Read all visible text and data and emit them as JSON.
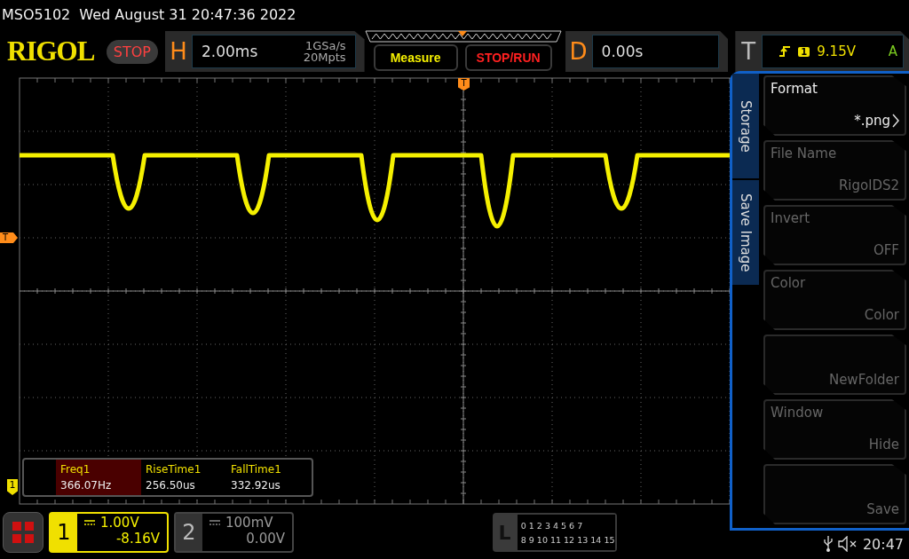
{
  "header": {
    "model": "MSO5102",
    "datetime": "Wed August 31 20:47:36 2022"
  },
  "logo": "RIGOL",
  "run_state": "STOP",
  "horizontal": {
    "label": "H",
    "timebase": "2.00ms",
    "sample_rate": "1GSa/s",
    "memory_depth": "20Mpts"
  },
  "buttons": [
    {
      "label": "Measure",
      "kind": "measure"
    },
    {
      "label": "STOP/RUN",
      "kind": "runstop"
    }
  ],
  "delay": {
    "label": "D",
    "value": "0.00s"
  },
  "trigger": {
    "label": "T",
    "source": "1",
    "level": "9.15V",
    "mode": "A"
  },
  "markers": {
    "trigger_position": "T",
    "trigger_level": "T",
    "channel": "1"
  },
  "measurements": [
    {
      "name": "Freq1",
      "value": "366.07Hz",
      "selected": true
    },
    {
      "name": "RiseTime1",
      "value": "256.50us",
      "selected": false
    },
    {
      "name": "FallTime1",
      "value": "332.92us",
      "selected": false
    }
  ],
  "channels": [
    {
      "number": "1",
      "scale": "1.00V",
      "offset": "-8.16V",
      "active": true
    },
    {
      "number": "2",
      "scale": "100mV",
      "offset": "0.00V",
      "active": false
    }
  ],
  "logic": {
    "label": "L",
    "rows": [
      "0 1 2 3 4 5 6 7",
      "8 9 10 11 12 13 14 15"
    ]
  },
  "menu": {
    "tabs": [
      "Storage",
      "Save Image"
    ],
    "items": [
      {
        "label": "Format",
        "value": "*.png",
        "disabled": false,
        "submenu": true
      },
      {
        "label": "File Name",
        "value": "RigolDS2",
        "disabled": true,
        "submenu": false
      },
      {
        "label": "Invert",
        "value": "OFF",
        "disabled": true,
        "submenu": false
      },
      {
        "label": "Color",
        "value": "Color",
        "disabled": true,
        "submenu": false
      },
      {
        "value": "NewFolder",
        "disabled": true,
        "submenu": false
      },
      {
        "label": "Window",
        "value": "Hide",
        "disabled": true,
        "submenu": false
      },
      {
        "value": "Save",
        "disabled": true,
        "submenu": false
      }
    ]
  },
  "status": {
    "time": "20:47"
  }
}
